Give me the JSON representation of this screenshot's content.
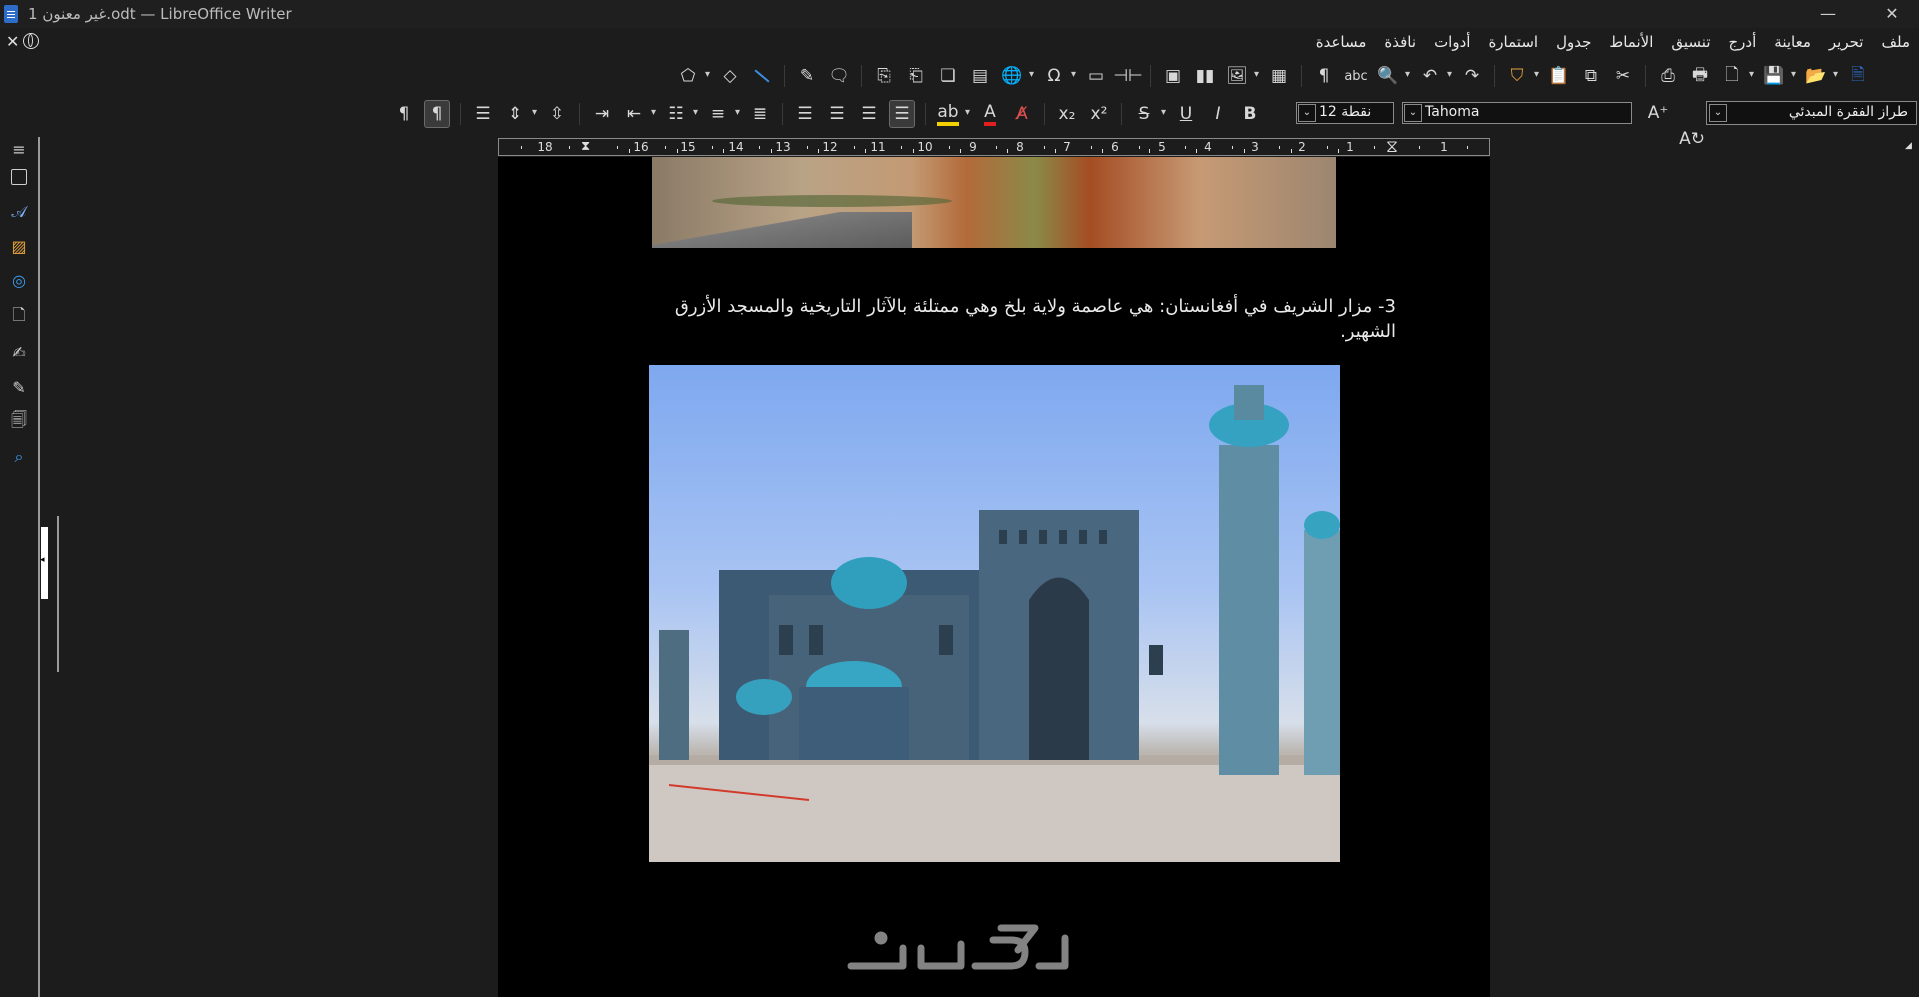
{
  "window": {
    "title": "غير معنون 1.odt — LibreOffice Writer",
    "minimize": "—",
    "restore": "❐",
    "close": "✕"
  },
  "menu": {
    "close_doc": "✕",
    "items": [
      "ملف",
      "تحرير",
      "معاينة",
      "أدرج",
      "تنسيق",
      "الأنماط",
      "جدول",
      "استمارة",
      "أدوات",
      "نافذة",
      "مساعدة"
    ]
  },
  "formatting": {
    "paragraph_style": "طراز الفقرة المبدئي",
    "font_name": "Tahoma",
    "font_size": "نقطة 12"
  },
  "ruler": {
    "numbers": [
      "18",
      "16",
      "15",
      "14",
      "13",
      "12",
      "11",
      "10",
      "9",
      "8",
      "7",
      "6",
      "5",
      "4",
      "3",
      "2",
      "1",
      "1"
    ]
  },
  "document": {
    "paragraph_3": "3- مزار الشريف في أفغانستان: هي عاصمة ولاية بلخ وهي ممتلئة بالآثار التاريخية والمسجد الأزرق الشهير."
  },
  "watermark": "خمسات",
  "colors": {
    "accent_blue": "#2d6dc9",
    "highlight_yellow": "#f2d100",
    "font_red": "#e02020",
    "save_purple": "#b04fd0",
    "open_orange": "#e8a33b"
  }
}
